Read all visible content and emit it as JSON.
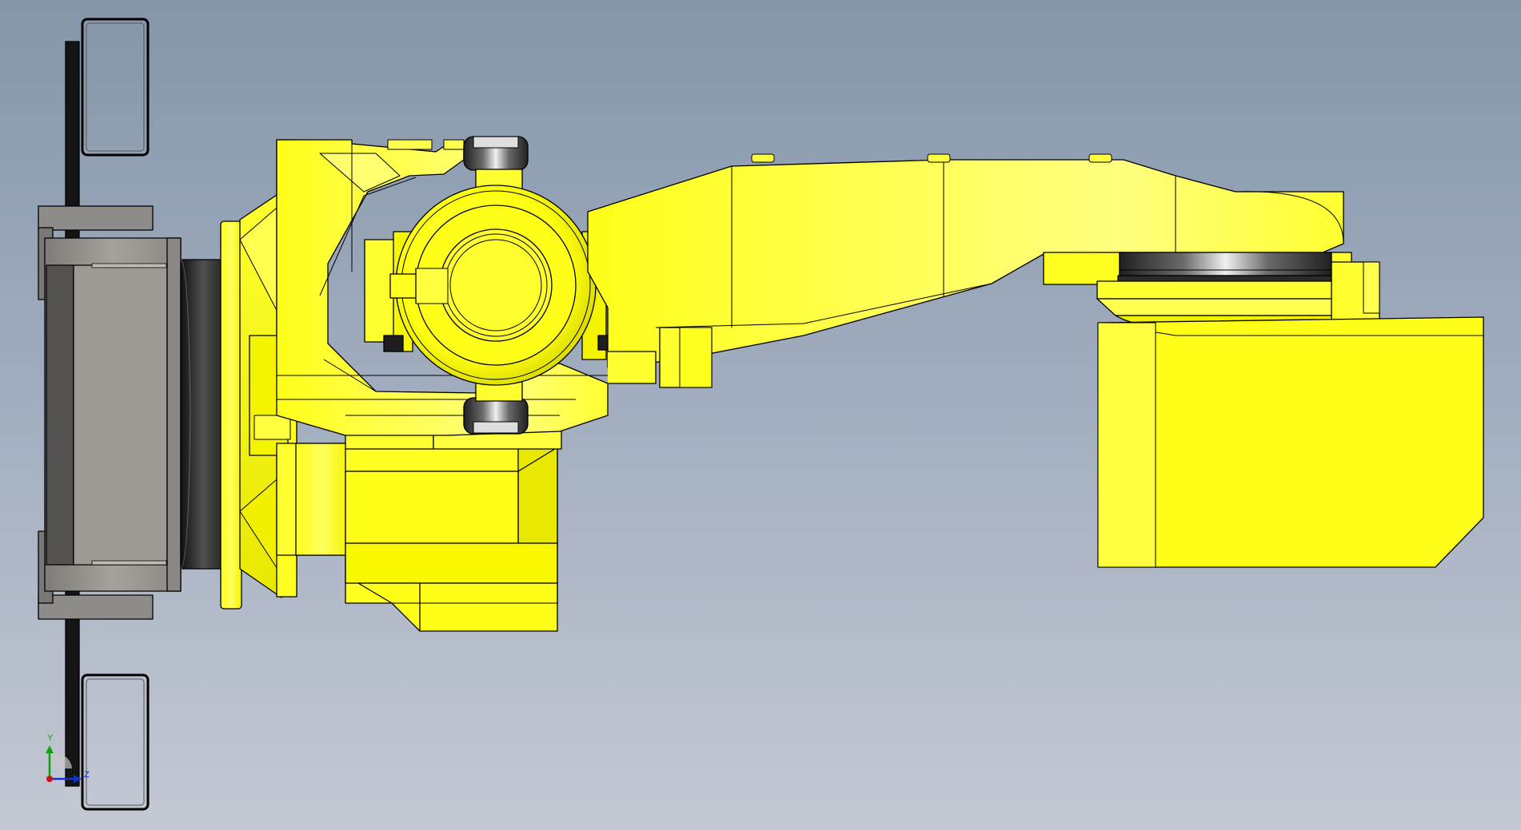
{
  "view": {
    "background_top": "#8596aa",
    "background_bottom": "#c4c9d3",
    "part_color": "#ffff1a",
    "part_highlight": "#ffff8c",
    "part_shade": "#c8c800",
    "edge_color": "#000000",
    "metal_color": "#9c9a94",
    "dark_color": "#1e1e1e"
  },
  "triad": {
    "x_label": "",
    "y_label": "Y",
    "z_label": "Z",
    "x_color": "#d01010",
    "y_color": "#10a010",
    "z_color": "#1030d0"
  }
}
